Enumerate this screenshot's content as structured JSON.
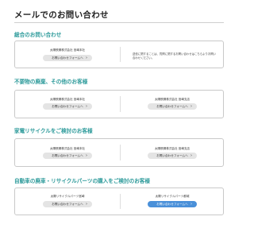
{
  "page": {
    "title": "メールでのお問い合わせ"
  },
  "sections": [
    {
      "heading": "総合のお問い合わせ",
      "left": {
        "label": "太陽鉄鋼株式会社 宮崎本社",
        "button": "お問い合わせフォームへ"
      },
      "note": "送信に関することは、質問に関するお問い合わせはこちらよりお問い合わせください。"
    },
    {
      "heading": "不要物の廃棄、その他のお客様",
      "left": {
        "label": "太陽鉄鋼株式会社 宮崎本社",
        "button": "お問い合わせフォームへ"
      },
      "right": {
        "label": "太陽鉄鋼株式会社 宮崎支店",
        "button": "お問い合わせフォームへ"
      }
    },
    {
      "heading": "家電リサイクルをご検討のお客様",
      "left": {
        "label": "太陽鉄鋼株式会社 宮崎本社",
        "button": "お問い合わせフォームへ"
      },
      "right": {
        "label": "太陽鉄鋼株式会社 宮崎支店",
        "button": "お問い合わせフォームへ"
      }
    },
    {
      "heading": "自動車の廃車・リサイクルパーツの購入をご検討のお客様",
      "left": {
        "label": "太陽リサイクルパーツ宮崎",
        "button": "お問い合わせフォームへ"
      },
      "right": {
        "label": "太陽リサイクルパーツ都城",
        "button": "お問い合わせフォームへ"
      }
    }
  ],
  "colors": {
    "section_heading": "#2e9b9b",
    "primary_button": "#4a90d9",
    "button": "#e4e4e4"
  },
  "icons": {
    "button_arrow": "chevron-right-icon"
  }
}
